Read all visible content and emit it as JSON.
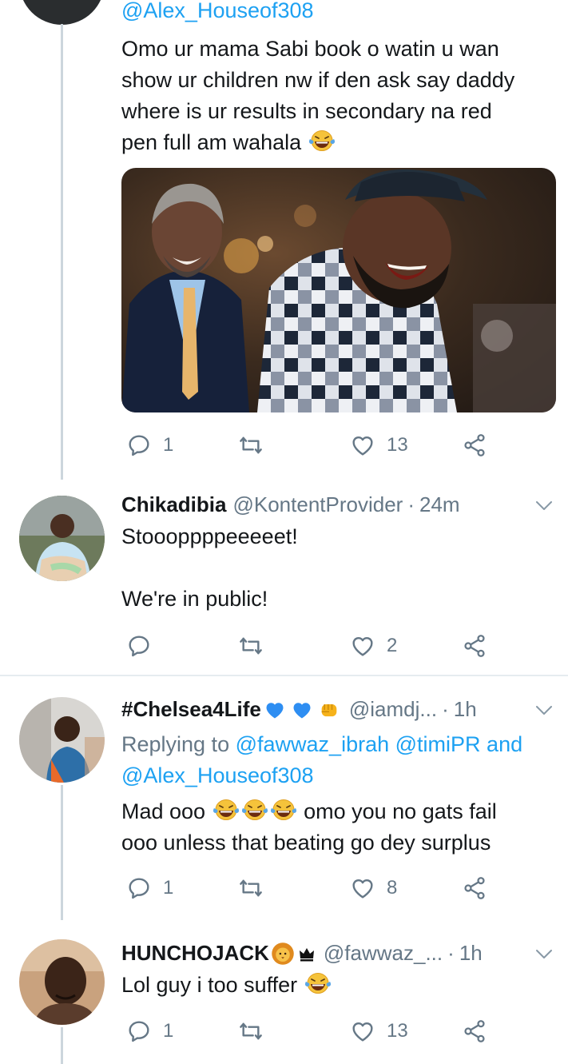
{
  "tweets": [
    {
      "handle_top": "@Alex_Houseof308",
      "text_lines": [
        "Omo ur mama Sabi book  o watin u wan",
        "show ur children nw if den ask say daddy",
        "where is ur results in secondary na red",
        "pen full am wahala"
      ],
      "actions": {
        "replies": "1",
        "likes": "13"
      }
    },
    {
      "name": "Chikadibia",
      "handle": "@KontentProvider",
      "dot": "·",
      "time": "24m",
      "text_line1": "Stoooppppeeeeet!",
      "text_line2": "We're in public!",
      "actions": {
        "replies": "",
        "likes": "2"
      }
    },
    {
      "name": "#Chelsea4Life",
      "handle": "@iamdj...",
      "dot": "·",
      "time": "1h",
      "replying_prefix": "Replying to",
      "mention1": "@fawwaz_ibrah",
      "mention2": "@timiPR",
      "and": "and",
      "mention3": "@Alex_Houseof308",
      "text_line1_a": "Mad ooo",
      "text_line1_b": "omo you no gats fail",
      "text_line2": "ooo unless that beating go dey surplus",
      "actions": {
        "replies": "1",
        "likes": "8"
      }
    },
    {
      "name": "HUNCHOJACK",
      "handle": "@fawwaz_...",
      "dot": "·",
      "time": "1h",
      "text_line1": "Lol guy i too suffer",
      "actions": {
        "replies": "1",
        "likes": "13"
      }
    }
  ],
  "icons": [
    "reply-icon",
    "retweet-icon",
    "like-icon",
    "share-icon",
    "chevron-down-icon",
    "laughing-emoji-icon",
    "blue-heart-icon",
    "fist-icon",
    "lion-icon",
    "crown-icon"
  ],
  "colors": {
    "text": "#14171a",
    "secondary": "#657786",
    "link": "#1da1f2",
    "divider": "#e6ecf0",
    "thread": "#ccd6dd"
  }
}
